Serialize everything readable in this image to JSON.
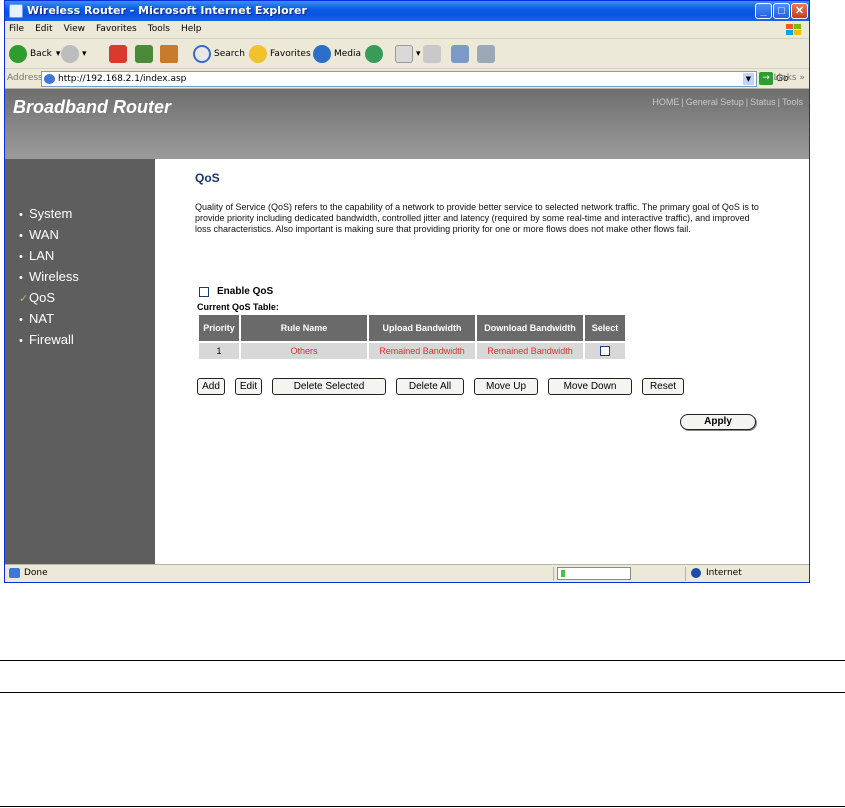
{
  "window": {
    "title": "Wireless Router - Microsoft Internet Explorer",
    "controls": {
      "minimize": "_",
      "maximize": "□",
      "close": "✕"
    }
  },
  "menu": [
    "File",
    "Edit",
    "View",
    "Favorites",
    "Tools",
    "Help"
  ],
  "toolbar": {
    "back": "Back",
    "search": "Search",
    "favorites": "Favorites",
    "media": "Media"
  },
  "address": {
    "label": "Address",
    "url": "http://192.168.2.1/index.asp",
    "go": "Go",
    "links": "Links"
  },
  "router": {
    "brand": "Broadband Router",
    "topnav": [
      "HOME",
      "General Setup",
      "Status",
      "Tools"
    ],
    "sidebar": [
      "System",
      "WAN",
      "LAN",
      "Wireless",
      "QoS",
      "NAT",
      "Firewall"
    ],
    "active_item": "QoS"
  },
  "page": {
    "title": "QoS",
    "description": "Quality of Service (QoS) refers to the capability of a network to provide better service to selected network traffic. The primary goal of QoS is to provide priority including dedicated bandwidth, controlled jitter and latency (required by some real-time and interactive traffic), and improved loss characteristics. Also important is making sure that providing priority for one or more flows does not make other flows fail.",
    "enable_label": "Enable QoS",
    "enable_checked": false,
    "table_title": "Current QoS Table:",
    "table": {
      "headers": [
        "Priority",
        "Rule Name",
        "Upload Bandwidth",
        "Download Bandwidth",
        "Select"
      ],
      "rows": [
        {
          "priority": "1",
          "rule": "Others",
          "upload": "Remained Bandwidth",
          "download": "Remained Bandwidth",
          "select": false
        }
      ]
    },
    "buttons": {
      "add": "Add",
      "edit": "Edit",
      "delete_selected": "Delete Selected",
      "delete_all": "Delete All",
      "move_up": "Move Up",
      "move_down": "Move Down",
      "reset": "Reset",
      "apply": "Apply"
    }
  },
  "status": {
    "text": "Done",
    "zone": "Internet"
  },
  "colors": {
    "sidebar": "#5e5e5e",
    "banner": "#7a7a7a",
    "title": "#1a3670",
    "red_text": "#e03030",
    "header_cell": "#6a6a6a"
  }
}
